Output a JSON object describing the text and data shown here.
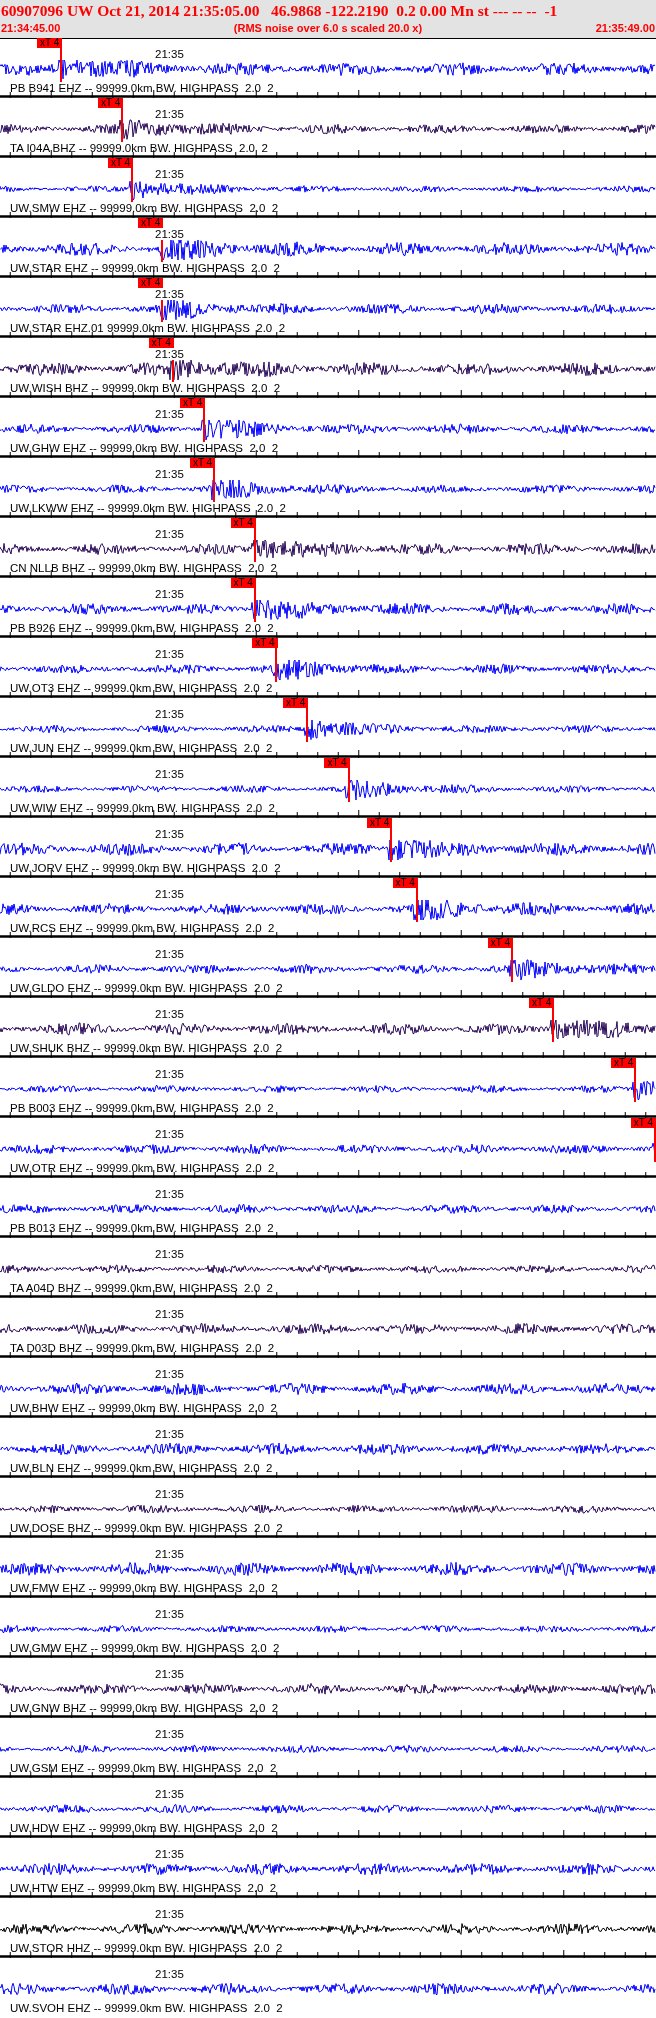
{
  "header": {
    "title": "60907096 UW Oct 21, 2014 21:35:05.00   46.9868 -122.2190  0.2 0.00 Mn st --- -- --  -1",
    "start_time": "21:34:45.00",
    "note": "(RMS noise over 6.0 s scaled 20.0 x)",
    "end_time": "21:35:49.00"
  },
  "traces": [
    {
      "label": "PB B941 EHZ -- 99999.0km BW. HIGHPASS  2.0  2",
      "time_mark": "21:35",
      "color": "#0000ff",
      "pick": {
        "label": "xT 4",
        "level": 0.095
      }
    },
    {
      "label": "TA I04A BHZ -- 99999.0km BW. HIGHPASS  2.0  2",
      "time_mark": "21:35",
      "color": "#2a0a5a",
      "pick": {
        "label": "xT 4",
        "level": 0.188
      }
    },
    {
      "label": "UW.SMW EHZ -- 99999.0km BW. HIGHPASS  2.0  2",
      "time_mark": "21:35",
      "color": "#0000ff",
      "pick": {
        "label": "xT 4",
        "level": 0.203
      }
    },
    {
      "label": "UW.STAR EHZ -- 99999.0km BW. HIGHPASS  2.0  2",
      "time_mark": "21:35",
      "color": "#0000ff",
      "pick": {
        "label": "xT 4",
        "level": 0.249
      }
    },
    {
      "label": "UW.STAR EHZ.01 99999.0km BW. HIGHPASS  2.0  2",
      "time_mark": "21:35",
      "color": "#0000ff",
      "pick": {
        "label": "xT 4",
        "level": 0.249
      }
    },
    {
      "label": "UW.WISH BHZ -- 99999.0km BW. HIGHPASS  2.0  2",
      "time_mark": "21:35",
      "color": "#2a0a5a",
      "pick": {
        "label": "xT 4",
        "level": 0.265
      }
    },
    {
      "label": "UW.GHW EHZ -- 99999.0km BW. HIGHPASS  2.0  2",
      "time_mark": "21:35",
      "color": "#0000ff",
      "pick": {
        "label": "xT 4",
        "level": 0.313
      }
    },
    {
      "label": "UW.LKWW EHZ -- 99999.0km BW. HIGHPASS  2.0  2",
      "time_mark": "21:35",
      "color": "#0000ff",
      "pick": {
        "label": "xT 4",
        "level": 0.328
      }
    },
    {
      "label": "CN NLLB BHZ -- 99999.0km BW. HIGHPASS  2.0  2",
      "time_mark": "21:35",
      "color": "#2a0a5a",
      "pick": {
        "label": "xT 4",
        "level": 0.39
      }
    },
    {
      "label": "PB B926 EHZ -- 99999.0km BW. HIGHPASS  2.0  2",
      "time_mark": "21:35",
      "color": "#0000ff",
      "pick": {
        "label": "xT 4",
        "level": 0.39
      }
    },
    {
      "label": "UW.OT3 EHZ -- 99999.0km BW. HIGHPASS  2.0  2",
      "time_mark": "21:35",
      "color": "#0000ff",
      "pick": {
        "label": "xT 4",
        "level": 0.423
      }
    },
    {
      "label": "UW.JUN EHZ -- 99999.0km BW. HIGHPASS  2.0  2",
      "time_mark": "21:35",
      "color": "#0000ff",
      "pick": {
        "label": "xT 4",
        "level": 0.47
      }
    },
    {
      "label": "UW.WIW EHZ -- 99999.0km BW. HIGHPASS  2.0  2",
      "time_mark": "21:35",
      "color": "#0000ff",
      "pick": {
        "label": "xT 4",
        "level": 0.533
      }
    },
    {
      "label": "UW.JORV EHZ -- 99999.0km BW. HIGHPASS  2.0  2",
      "time_mark": "21:35",
      "color": "#0000ff",
      "pick": {
        "label": "xT 4",
        "level": 0.598
      }
    },
    {
      "label": "UW.RCS EHZ -- 99999.0km BW. HIGHPASS  2.0  2",
      "time_mark": "21:35",
      "color": "#0000ff",
      "pick": {
        "label": "xT 4",
        "level": 0.637
      }
    },
    {
      "label": "UW.GLDO EHZ -- 99999.0km BW. HIGHPASS  2.0  2",
      "time_mark": "21:35",
      "color": "#0000ff",
      "pick": {
        "label": "xT 4",
        "level": 0.782
      }
    },
    {
      "label": "UW.SHUK BHZ -- 99999.0km BW. HIGHPASS  2.0  2",
      "time_mark": "21:35",
      "color": "#2a0a5a",
      "pick": {
        "label": "xT 4",
        "level": 0.845
      }
    },
    {
      "label": "PB B003 EHZ -- 99999.0km BW. HIGHPASS  2.0  2",
      "time_mark": "21:35",
      "color": "#0000ff",
      "pick": {
        "label": "xT 4",
        "level": 0.97
      }
    },
    {
      "label": "UW.OTR EHZ -- 99999.0km BW. HIGHPASS  2.0  2",
      "time_mark": "21:35",
      "color": "#0000ff",
      "pick": {
        "label": "xT 4",
        "level": 1.0
      }
    },
    {
      "label": "PB B013 EHZ -- 99999.0km BW. HIGHPASS  2.0  2",
      "time_mark": "21:35",
      "color": "#0000ff"
    },
    {
      "label": "TA A04D BHZ -- 99999.0km BW. HIGHPASS  2.0  2",
      "time_mark": "21:35",
      "color": "#2a0a5a"
    },
    {
      "label": "TA D03D BHZ -- 99999.0km BW. HIGHPASS  2.0  2",
      "time_mark": "21:35",
      "color": "#2a0a5a"
    },
    {
      "label": "UW.BHW EHZ -- 99999.0km BW. HIGHPASS  2.0  2",
      "time_mark": "21:35",
      "color": "#0000ff"
    },
    {
      "label": "UW.BLN EHZ -- 99999.0km BW. HIGHPASS  2.0  2",
      "time_mark": "21:35",
      "color": "#0000ff"
    },
    {
      "label": "UW.DOSE BHZ -- 99999.0km BW. HIGHPASS  2.0  2",
      "time_mark": "21:35",
      "color": "#2a0a5a"
    },
    {
      "label": "UW.FMW EHZ -- 99999.0km BW. HIGHPASS  2.0  2",
      "time_mark": "21:35",
      "color": "#0000ff"
    },
    {
      "label": "UW.GMW EHZ -- 99999.0km BW. HIGHPASS  2.0  2",
      "time_mark": "21:35",
      "color": "#0000ff"
    },
    {
      "label": "UW.GNW BHZ -- 99999.0km BW. HIGHPASS  2.0  2",
      "time_mark": "21:35",
      "color": "#2a0a5a"
    },
    {
      "label": "UW.GSM EHZ -- 99999.0km BW. HIGHPASS  2.0  2",
      "time_mark": "21:35",
      "color": "#0000ff"
    },
    {
      "label": "UW.HDW EHZ -- 99999.0km BW. HIGHPASS  2.0  2",
      "time_mark": "21:35",
      "color": "#0000ff"
    },
    {
      "label": "UW.HTW EHZ -- 99999.0km BW. HIGHPASS  2.0  2",
      "time_mark": "21:35",
      "color": "#0000ff"
    },
    {
      "label": "UW.STOR HHZ -- 99999.0km BW. HIGHPASS  2.0  2",
      "time_mark": "21:35",
      "color": "#000000"
    },
    {
      "label": "UW.SVOH EHZ -- 99999.0km BW. HIGHPASS  2.0  2",
      "time_mark": "21:35",
      "color": "#0000ff"
    }
  ]
}
